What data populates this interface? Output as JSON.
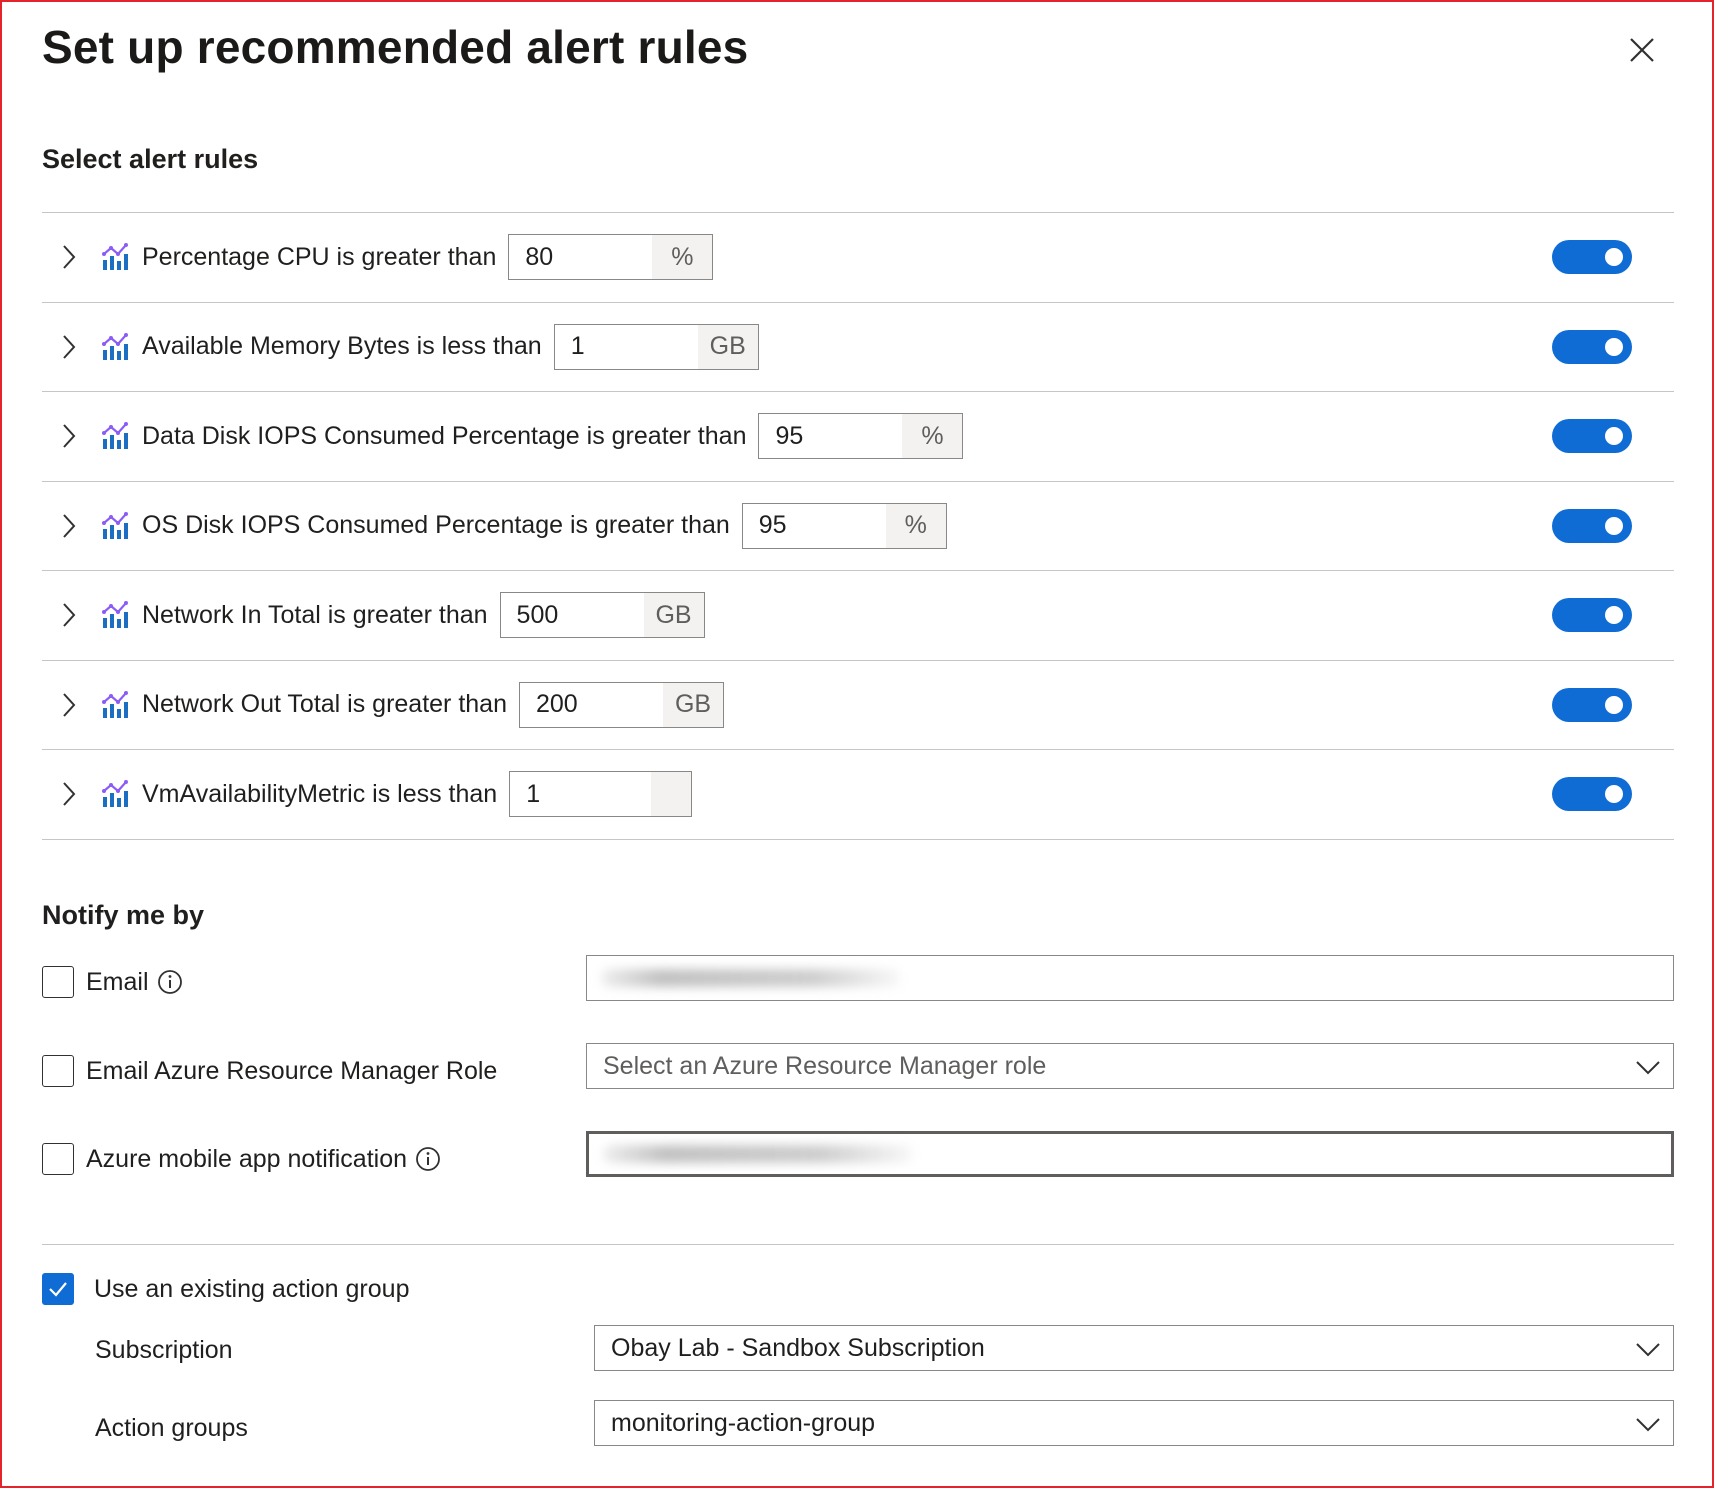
{
  "dialog": {
    "title": "Set up recommended alert rules",
    "close_icon": "close-icon"
  },
  "alert_rules": {
    "heading": "Select alert rules",
    "items": [
      {
        "label": "Percentage CPU is greater than",
        "value": "80",
        "unit": "%",
        "enabled": true
      },
      {
        "label": "Available Memory Bytes is less than",
        "value": "1",
        "unit": "GB",
        "enabled": true
      },
      {
        "label": "Data Disk IOPS Consumed Percentage is greater than",
        "value": "95",
        "unit": "%",
        "enabled": true
      },
      {
        "label": "OS Disk IOPS Consumed Percentage is greater than",
        "value": "95",
        "unit": "%",
        "enabled": true
      },
      {
        "label": "Network In Total is greater than",
        "value": "500",
        "unit": "GB",
        "enabled": true
      },
      {
        "label": "Network Out Total is greater than",
        "value": "200",
        "unit": "GB",
        "enabled": true
      },
      {
        "label": "VmAvailabilityMetric is less than",
        "value": "1",
        "unit": "",
        "enabled": true
      }
    ]
  },
  "notify": {
    "heading": "Notify me by",
    "email": {
      "label": "Email",
      "checked": false
    },
    "arm_role": {
      "label": "Email Azure Resource Manager Role",
      "checked": false,
      "placeholder": "Select an Azure Resource Manager role"
    },
    "mobile": {
      "label": "Azure mobile app notification",
      "checked": false
    }
  },
  "action_group": {
    "use_existing_label": "Use an existing action group",
    "checked": true,
    "subscription_label": "Subscription",
    "subscription_value": "Obay Lab - Sandbox Subscription",
    "action_groups_label": "Action groups",
    "action_groups_value": "monitoring-action-group"
  },
  "colors": {
    "accent": "#0f6cd4",
    "frame_border": "#e3242b"
  }
}
